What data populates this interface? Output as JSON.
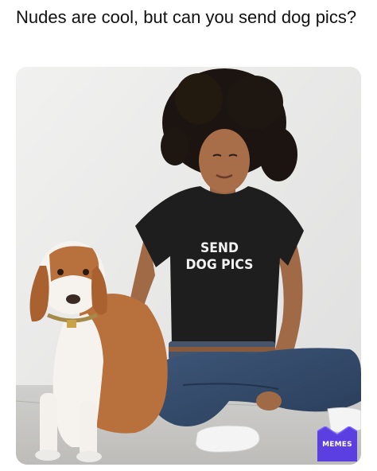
{
  "post": {
    "caption": "Nudes are cool, but can you send dog pics?"
  },
  "photo": {
    "description_icon": "photo-woman-with-dog",
    "shirt_text_line1": "SEND",
    "shirt_text_line2": "DOG PICS"
  },
  "watermark": {
    "label": "MEMES",
    "color": "#5b3fe0"
  }
}
